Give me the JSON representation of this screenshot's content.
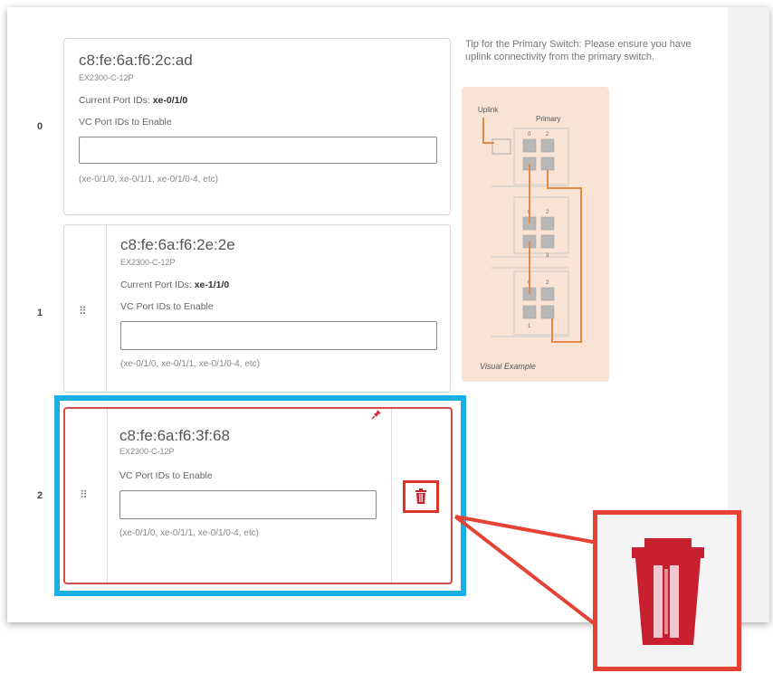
{
  "tip": {
    "text": "Tip for the Primary Switch: Please ensure you have uplink connectivity from the primary switch."
  },
  "diagram": {
    "uplink_label": "Uplink",
    "primary_label": "Primary",
    "caption": "Visual Example",
    "port_numbers": [
      "0",
      "2",
      "0",
      "2",
      "3",
      "0",
      "2",
      "1"
    ]
  },
  "members": [
    {
      "index": "0",
      "mac": "c8:fe:6a:f6:2c:ad",
      "model": "EX2300-C-12P",
      "current_ports_label": "Current Port IDs:",
      "current_ports_value": "xe-0/1/0",
      "vc_label": "VC Port IDs to Enable",
      "vc_value": "",
      "hint": "(xe-0/1/0, xe-0/1/1, xe-0/1/0-4, etc)"
    },
    {
      "index": "1",
      "mac": "c8:fe:6a:f6:2e:2e",
      "model": "EX2300-C-12P",
      "current_ports_label": "Current Port IDs:",
      "current_ports_value": "xe-1/1/0",
      "vc_label": "VC Port IDs to Enable",
      "vc_value": "",
      "hint": "(xe-0/1/0, xe-0/1/1, xe-0/1/0-4, etc)"
    },
    {
      "index": "2",
      "mac": "c8:fe:6a:f6:3f:68",
      "model": "EX2300-C-12P",
      "vc_label": "VC Port IDs to Enable",
      "vc_value": "",
      "hint": "(xe-0/1/0, xe-0/1/1, xe-0/1/0-4, etc)"
    }
  ],
  "icons": {
    "drag": "drag-handle-icon",
    "trash": "trash-icon",
    "pin": "pin-icon"
  },
  "colors": {
    "highlight": "#1ab0e5",
    "callout": "#e54233",
    "trash": "#c8202f",
    "diagram_bg": "#f8e3d5",
    "cable": "#e08a45"
  }
}
